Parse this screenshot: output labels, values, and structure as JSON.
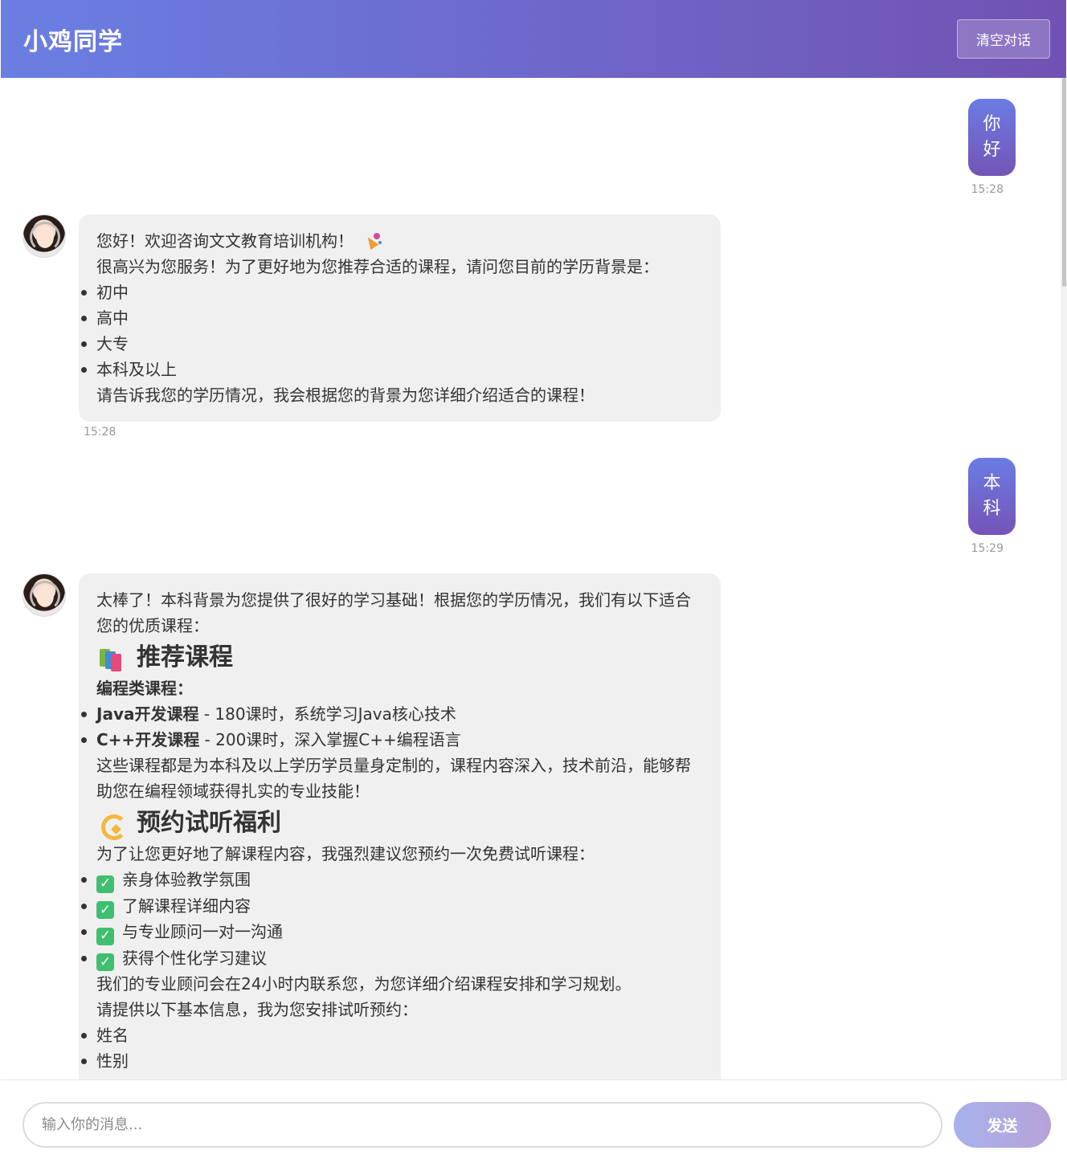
{
  "header": {
    "title": "小鸡同学",
    "clear_button": "清空对话"
  },
  "conversation": {
    "user_msg_1": {
      "chars": [
        "你",
        "好"
      ],
      "time": "15:28"
    },
    "bot_msg_1": {
      "line1": "您好！欢迎咨询文文教育培训机构！",
      "party_icon": "party-popper-icon",
      "line2": "很高兴为您服务！为了更好地为您推荐合适的课程，请问您目前的学历背景是：",
      "options": [
        "初中",
        "高中",
        "大专",
        "本科及以上"
      ],
      "closing": "请告诉我您的学历情况，我会根据您的背景为您详细介绍适合的课程！",
      "time": "15:28"
    },
    "user_msg_2": {
      "chars": [
        "本",
        "科"
      ],
      "time": "15:29"
    },
    "bot_msg_2": {
      "intro": "太棒了！本科背景为您提供了很好的学习基础！根据您的学历情况，我们有以下适合您的优质课程：",
      "heading1": "推荐课程",
      "heading1_icon": "books-icon",
      "category": "编程类课程：",
      "courses": [
        {
          "name": "Java开发课程",
          "desc": " - 180课时，系统学习Java核心技术"
        },
        {
          "name": "C++开发课程",
          "desc": " - 200课时，深入掌握C++编程语言"
        }
      ],
      "courses_note": "这些课程都是为本科及以上学历学员量身定制的，课程内容深入，技术前沿，能够帮助您在编程领域获得扎实的专业技能！",
      "heading2": "预约试听福利",
      "heading2_icon": "dizzy-icon",
      "trial_intro": "为了让您更好地了解课程内容，我强烈建议您预约一次免费试听课程：",
      "benefits": [
        "亲身体验教学氛围",
        "了解课程详细内容",
        "与专业顾问一对一沟通",
        "获得个性化学习建议"
      ],
      "contact_note": "我们的专业顾问会在24小时内联系您，为您详细介绍课程安排和学习规划。",
      "info_request": "请提供以下基本信息，我为您安排试听预约：",
      "fields": [
        "姓名",
        "性别"
      ]
    }
  },
  "composer": {
    "placeholder": "输入你的消息...",
    "send_label": "发送"
  },
  "colors": {
    "header_start": "#6a7fe3",
    "header_end": "#7152b3",
    "bot_bubble": "#f0f0f0",
    "check": "#3fbf6f"
  }
}
